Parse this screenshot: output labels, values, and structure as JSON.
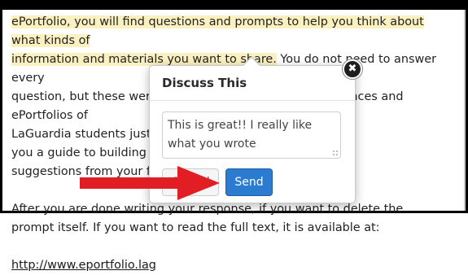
{
  "article": {
    "line1": "ePortfolio, you will find questions and prompts to help you think about what kinds of",
    "line2a": "information and materials you want to share.",
    "line2b": "  You do not need to answer every",
    "line3": "question, but these were developed based on the experiences and ePortfolios of",
    "line4": "LaGuardia students just like you. They are meant to offer",
    "line5": "you a guide to building your ePortfolio with guidance and",
    "line6": "suggestions from your faculty.",
    "line7": "After you are done writing your response, if you want to delete the",
    "line8": "prompt itself.  If you want to read the full text, it is available at:",
    "link": "http://www.eportfolio.lag"
  },
  "popover": {
    "title": "Discuss This",
    "comment_value": "This is great!! I really like what you wrote",
    "cancel_label": "Cancel",
    "send_label": "Send",
    "close_glyph": "✖"
  },
  "colors": {
    "highlight": "#fbf1c0",
    "send_button": "#2b7bd0",
    "arrow": "#e01e24"
  },
  "annotation": {
    "icon": "red-arrow-icon"
  }
}
